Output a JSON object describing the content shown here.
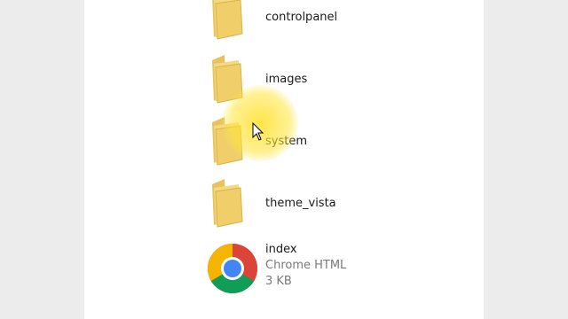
{
  "files": [
    {
      "name": "controlpanel",
      "type": "folder",
      "icon": "folder-icon"
    },
    {
      "name": "images",
      "type": "folder",
      "icon": "folder-icon"
    },
    {
      "name": "system",
      "type": "folder",
      "icon": "folder-icon"
    },
    {
      "name": "theme_vista",
      "type": "folder",
      "icon": "folder-icon"
    },
    {
      "name": "index",
      "type": "Chrome HTML",
      "size": "3 KB",
      "icon": "chrome-icon"
    }
  ],
  "colors": {
    "folder": "#f2cf6e",
    "highlight": "#ffe028"
  }
}
